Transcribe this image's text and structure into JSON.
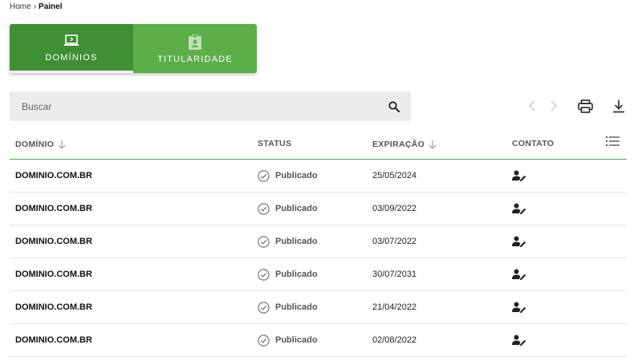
{
  "breadcrumb": {
    "home": "Home",
    "separator": "›",
    "current": "Painel"
  },
  "tabs": [
    {
      "label": "DOMÍNIOS",
      "icon": "laptop-icon",
      "active": true
    },
    {
      "label": "TITULARIDADE",
      "icon": "id-badge-icon",
      "active": false
    }
  ],
  "search": {
    "placeholder": "Buscar",
    "value": "",
    "icon": "search-icon"
  },
  "toolbar": {
    "prev_icon": "chevron-left-icon",
    "next_icon": "chevron-right-icon",
    "print_icon": "print-icon",
    "download_icon": "download-icon"
  },
  "table": {
    "headers": {
      "domain": "DOMÍNIO",
      "status": "STATUS",
      "expiration": "EXPIRAÇÃO",
      "contact": "CONTATO"
    },
    "columns_menu_icon": "list-icon",
    "rows": [
      {
        "domain": "DOMINIO.COM.BR",
        "status": "Publicado",
        "expiration": "25/05/2024"
      },
      {
        "domain": "DOMINIO.COM.BR",
        "status": "Publicado",
        "expiration": "03/09/2022"
      },
      {
        "domain": "DOMINIO.COM.BR",
        "status": "Publicado",
        "expiration": "03/07/2022"
      },
      {
        "domain": "DOMINIO.COM.BR",
        "status": "Publicado",
        "expiration": "30/07/2031"
      },
      {
        "domain": "DOMINIO.COM.BR",
        "status": "Publicado",
        "expiration": "21/04/2022"
      },
      {
        "domain": "DOMINIO.COM.BR",
        "status": "Publicado",
        "expiration": "02/08/2022"
      }
    ]
  },
  "colors": {
    "tab_active": "#3f8f35",
    "tab_inactive": "#5cae49",
    "header_divider": "#4caf50"
  }
}
